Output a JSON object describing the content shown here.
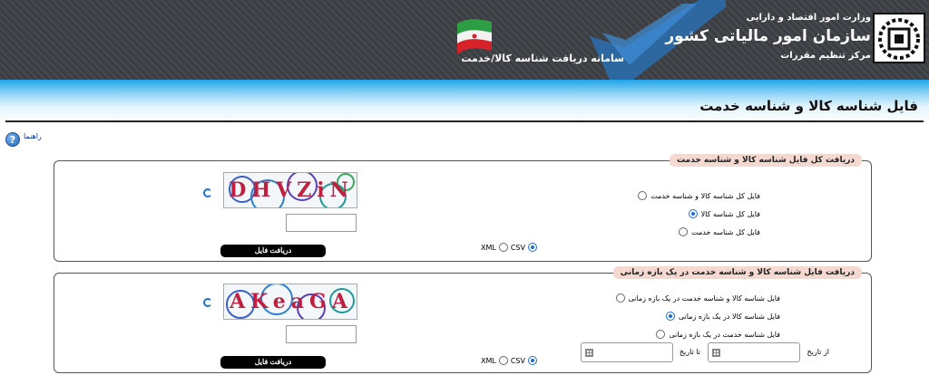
{
  "header": {
    "ministry": "وزارت امور اقتصاد و دارایی",
    "org_name": "سازمان امور مالیاتی کشور",
    "org_sub": "مرکز تنظیم مقررات",
    "system_name": "سامانه دریافت شناسه کالا/خدمت"
  },
  "page": {
    "title": "فایل شناسه کالا و شناسه خدمت",
    "help_label": "راهنما"
  },
  "section1": {
    "legend": "دریافت کل فایل شناسه کالا و شناسه خدمت",
    "options": [
      {
        "label": "فایل کل شناسه کالا و شناسه خدمت",
        "selected": false
      },
      {
        "label": "فایل کل شناسه کالا",
        "selected": true
      },
      {
        "label": "فایل کل شناسه خدمت",
        "selected": false
      }
    ],
    "formats": {
      "xml": "XML",
      "csv": "CSV",
      "selected": "CSV"
    },
    "captcha_text": "DHVZiN",
    "captcha_input_value": "",
    "download_label": "دریافت فایل"
  },
  "section2": {
    "legend": "دریافت فایل شناسه کالا و شناسه خدمت در یک بازه زمانی",
    "options": [
      {
        "label": "فایل شناسه کالا و شناسه خدمت در یک بازه زمانی",
        "selected": false
      },
      {
        "label": "فایل شناسه کالا در یک بازه زمانی",
        "selected": true
      },
      {
        "label": "فایل شناسه خدمت در یک بازه زمانی",
        "selected": false
      }
    ],
    "from_label": "از تاریخ",
    "to_label": "تا تاریخ",
    "from_value": "",
    "to_value": "",
    "formats": {
      "xml": "XML",
      "csv": "CSV",
      "selected": "CSV"
    },
    "captcha_text": "AKeaGA",
    "captcha_input_value": "",
    "download_label": "دریافت فایل"
  },
  "colors": {
    "accent": "#1a6fd6",
    "legend_bg": "#f5d9d0",
    "header_bg": "#3a3d42",
    "title_gradient_top": "#1da2e8"
  }
}
